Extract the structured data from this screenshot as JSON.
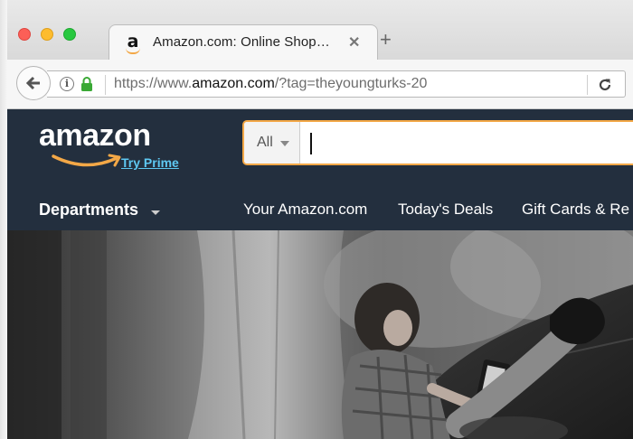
{
  "browser": {
    "tab": {
      "favicon": "a",
      "title": "Amazon.com: Online Shop…"
    },
    "new_tab_symbol": "+",
    "close_symbol": "✕",
    "url": {
      "scheme": "https://www.",
      "domain": "amazon.com",
      "path": "/?tag=theyoungturks-20"
    },
    "icons": [
      "back-arrow-icon",
      "info-icon",
      "lock-icon",
      "reload-icon"
    ],
    "info_glyph": "i"
  },
  "amazon": {
    "logo_text": "amazon",
    "try_prime": "Try Prime",
    "search": {
      "department": "All",
      "value": ""
    },
    "nav": {
      "departments": "Departments",
      "links": [
        "Your Amazon.com",
        "Today's Deals",
        "Gift Cards & Re"
      ]
    }
  },
  "colors": {
    "header_bg": "#232f3e",
    "search_border": "#f3a847",
    "prime_link": "#5ec8f2",
    "lock_green": "#3aa935"
  },
  "hero": {
    "description_icon": "photo-girl-reading-ereader"
  }
}
